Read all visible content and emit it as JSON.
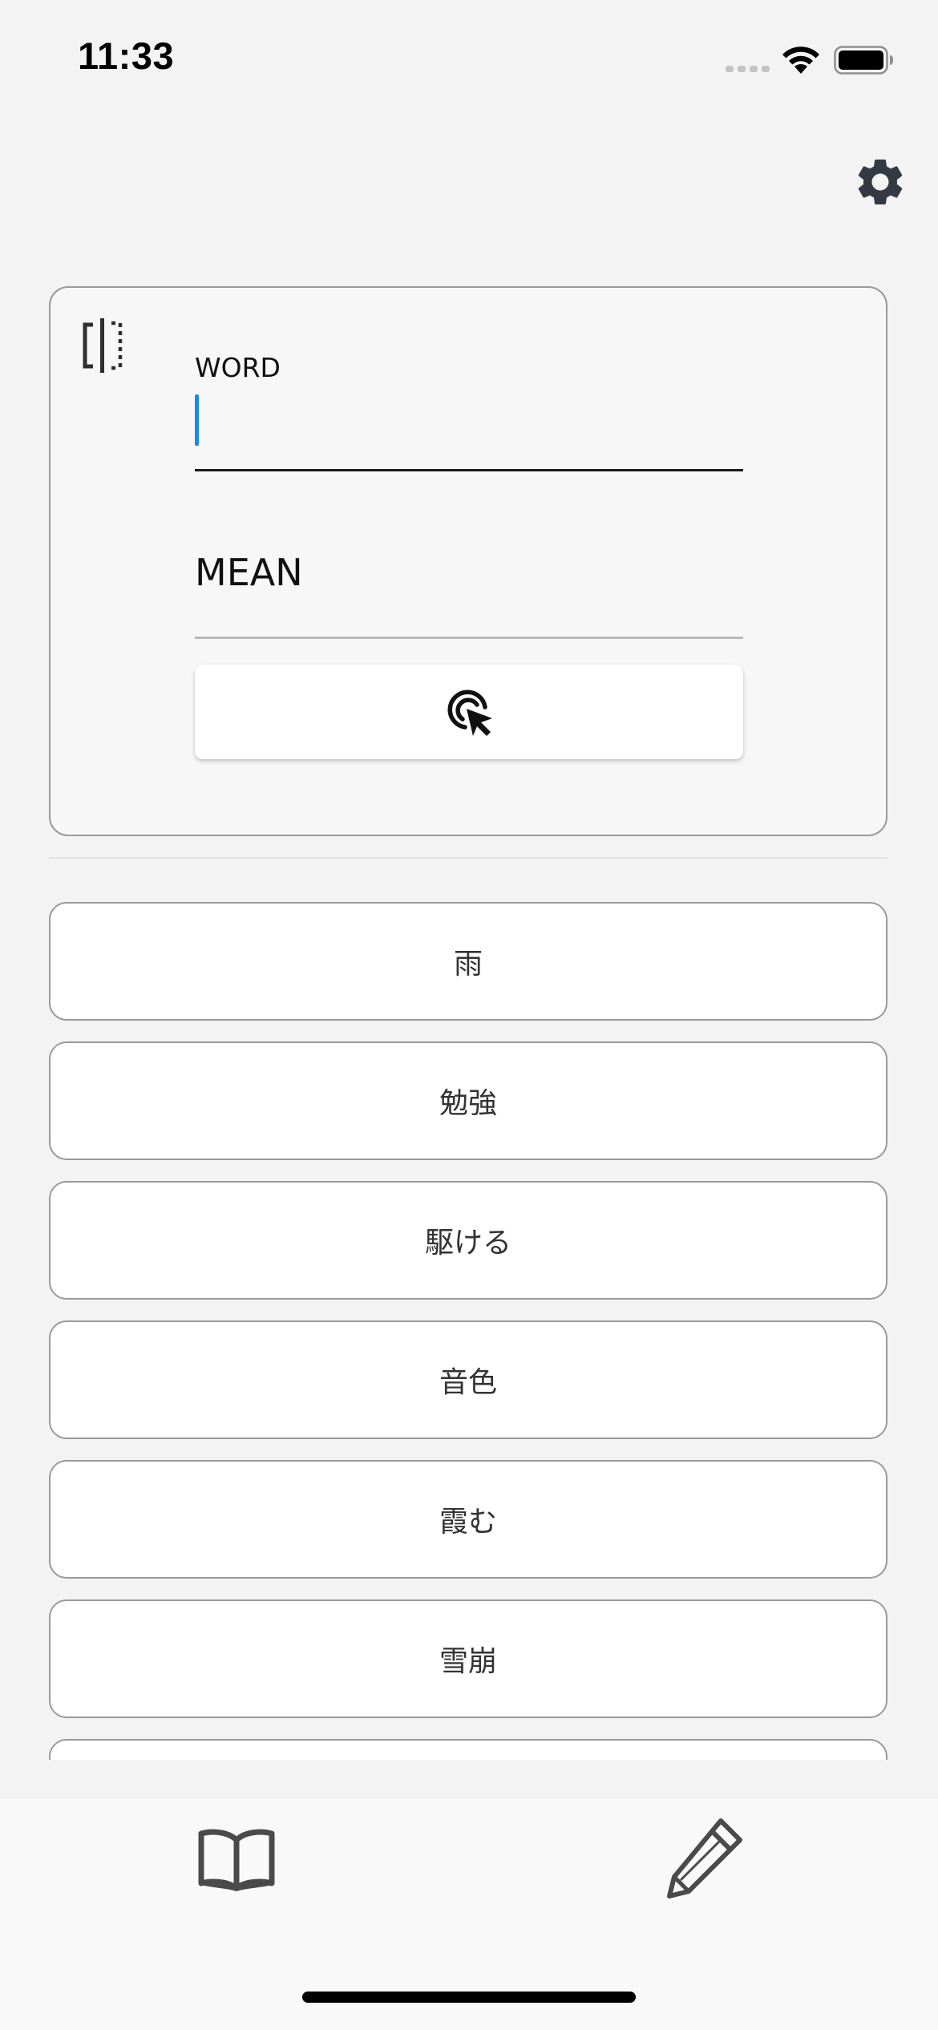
{
  "status_bar": {
    "time": "11:33"
  },
  "icons": {
    "settings": "gear-icon",
    "flip": "flip-horizontal-icon",
    "add": "cursor-click-icon",
    "dictionary": "open-book-icon",
    "edit": "pencil-icon"
  },
  "form": {
    "word_label": "WORD",
    "word_value": "",
    "mean_placeholder": "MEAN",
    "mean_value": ""
  },
  "words": [
    "雨",
    "勉強",
    "駆ける",
    "音色",
    "霞む",
    "雪崩",
    ""
  ],
  "colors": {
    "background": "#f3f3f3",
    "card_border": "#9a9a9a",
    "caret": "#1e88e5",
    "icon": "#2f2f2f"
  }
}
